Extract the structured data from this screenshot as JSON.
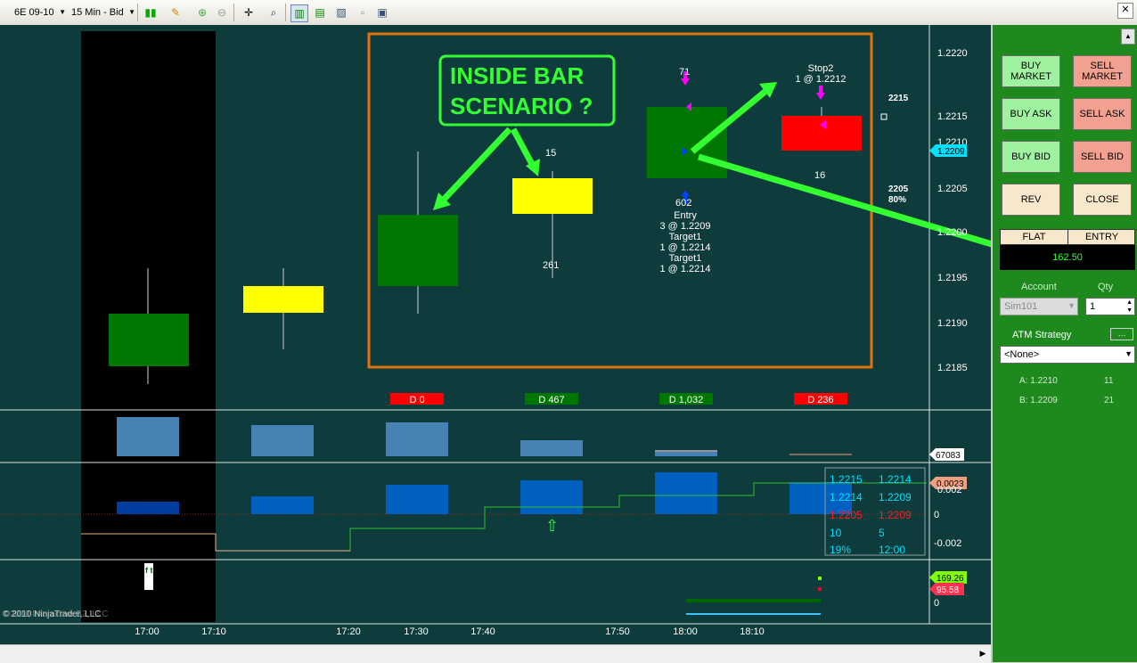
{
  "toolbar": {
    "instrument": "6E 09-10",
    "interval": "15 Min - Bid",
    "icons": [
      "candlestick-icon",
      "pencil-icon",
      "zoom-in-icon",
      "zoom-out-icon",
      "crosshair-icon",
      "magnify-icon",
      "bar-chart-icon",
      "toggle-chart-icon",
      "data-box-icon",
      "properties-icon",
      "window-icon"
    ]
  },
  "price_axis": {
    "ticks": [
      "1.2220",
      "1.2215",
      "1.2210",
      "1.2205",
      "1.2200",
      "1.2195",
      "1.2190",
      "1.2185"
    ],
    "current_price": "1.2209",
    "volume_label": "67083",
    "indicator_label": "0.0023",
    "indicator_ticks": [
      "0.002",
      "0",
      "-0.002"
    ],
    "panel4_labels": [
      "169.26",
      "95.58",
      "0"
    ]
  },
  "time_axis": [
    "17:00",
    "17:10",
    "17:20",
    "17:30",
    "17:40",
    "17:50",
    "18:00",
    "18:10"
  ],
  "annotation": {
    "line1": "INSIDE BAR",
    "line2": "SCENARIO ?"
  },
  "bar_labels": {
    "bar4_top": "15",
    "bar4_bottom": "261",
    "bar5_top": "71",
    "bar5_bottom": "602",
    "bar5_lines": [
      "Entry",
      "3 @ 1.2209",
      "Target1",
      "1 @ 1.2214",
      "Target1",
      "1 @ 1.2214"
    ],
    "bar6_stop": "Stop2",
    "bar6_stop_detail": "1 @ 1.2212",
    "bar6_bottom": "16"
  },
  "right_labels": {
    "upper": "2215",
    "lower": "2205",
    "pct": "80%"
  },
  "delta_labels": [
    "D 0",
    "D 467",
    "D 1,032",
    "D 236"
  ],
  "data_table": {
    "rows": [
      [
        "1.2215",
        "1.2214"
      ],
      [
        "1.2214",
        "1.2209"
      ],
      [
        "1.2205",
        "1.2209"
      ],
      [
        "10",
        "5"
      ],
      [
        "19%",
        "12:00"
      ]
    ]
  },
  "copyright": "© 2010 NinjaTrader, LLC",
  "copyright_overlay": "©2010 Interactive B2, LLC",
  "watermark": "f t",
  "panel": {
    "buy_market": "BUY MARKET",
    "sell_market": "SELL MARKET",
    "buy_ask": "BUY ASK",
    "sell_ask": "SELL ASK",
    "buy_bid": "BUY BID",
    "sell_bid": "SELL BID",
    "rev": "REV",
    "close": "CLOSE",
    "position_label": "FLAT",
    "entry_label": "ENTRY",
    "pnl": "162.50",
    "account_label": "Account",
    "qty_label": "Qty",
    "account_value": "Sim101",
    "qty_value": "1",
    "atm_label": "ATM Strategy",
    "atm_value": "<None>",
    "ask_label": "A: 1.2210",
    "ask_size": "11",
    "bid_label": "B: 1.2209",
    "bid_size": "21"
  },
  "colors": {
    "chart_bg": "#0e3b3b",
    "up_bar": "#007700",
    "inside_bar": "#ffff00",
    "down_bar": "#ff0000",
    "annotation_green": "#33ff33",
    "annotation_box": "#e07010",
    "panel_green": "#1e8a1e"
  }
}
